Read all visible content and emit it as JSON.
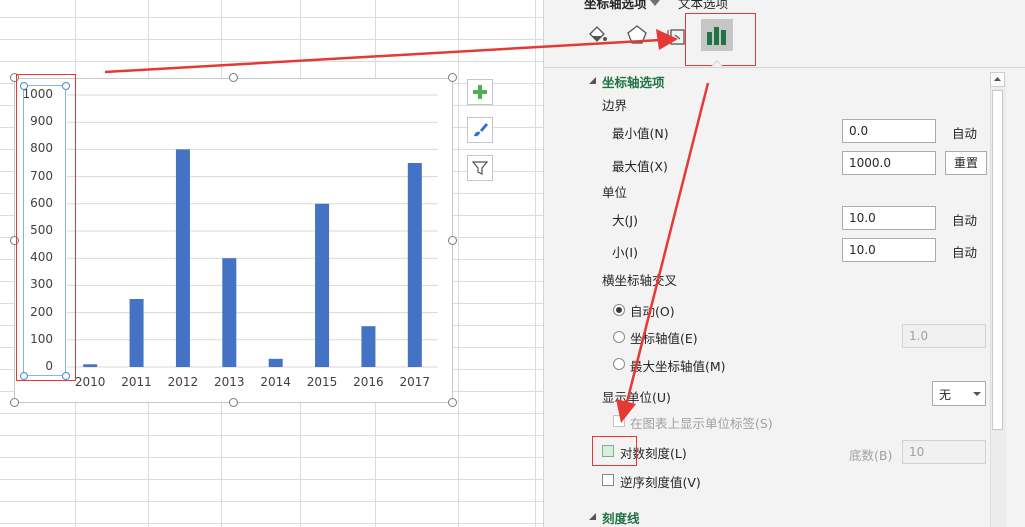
{
  "pane": {
    "tabs": [
      "坐标轴选项",
      "文本选项"
    ],
    "section_title": "坐标轴选项",
    "bounds_label": "边界",
    "min_label": "最小值(N)",
    "min_value": "0.0",
    "min_state": "自动",
    "max_label": "最大值(X)",
    "max_value": "1000.0",
    "max_button": "重置",
    "units_label": "单位",
    "major_label": "大(J)",
    "major_value": "10.0",
    "major_state": "自动",
    "minor_label": "小(I)",
    "minor_value": "10.0",
    "minor_state": "自动",
    "crosses_label": "横坐标轴交叉",
    "crosses_options": [
      "自动(O)",
      "坐标轴值(E)",
      "最大坐标轴值(M)"
    ],
    "crosses_value": "1.0",
    "display_units_label": "显示单位(U)",
    "display_units_value": "无",
    "show_units_label": "在图表上显示单位标签(S)",
    "log_scale_label": "对数刻度(L)",
    "base_label": "底数(B)",
    "base_value": "10",
    "reverse_label": "逆序刻度值(V)",
    "tick_marks_title": "刻度线"
  },
  "colors": {
    "bar": "#4472c4",
    "accent_green": "#217346",
    "arrow": "#e53935"
  },
  "chart_data": {
    "type": "bar",
    "categories": [
      "2010",
      "2011",
      "2012",
      "2013",
      "2014",
      "2015",
      "2016",
      "2017"
    ],
    "values": [
      10,
      250,
      800,
      400,
      30,
      600,
      150,
      750
    ],
    "ylim": [
      0,
      1000
    ],
    "yticks": [
      "0",
      "100",
      "200",
      "300",
      "400",
      "500",
      "600",
      "700",
      "800",
      "900",
      "1000"
    ],
    "grid": true
  }
}
